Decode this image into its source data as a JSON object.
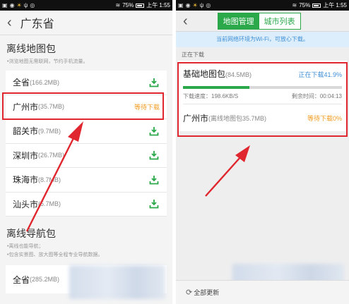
{
  "status_left": {
    "battery": "75%",
    "time": "上午 1:55"
  },
  "status_right": {
    "battery": "75%",
    "time": "上午 1:55"
  },
  "left": {
    "header_title": "广东省",
    "section_title": "离线地图包",
    "section_note": "•浏览地图无需联网，节约手机流量。",
    "items": [
      {
        "name": "全省",
        "size": "(166.2MB)"
      },
      {
        "name": "广州市",
        "size": "(35.7MB)",
        "status": "等待下载"
      },
      {
        "name": "韶关市",
        "size": "(9.7MB)"
      },
      {
        "name": "深圳市",
        "size": "(26.7MB)"
      },
      {
        "name": "珠海市",
        "size": "(8.7MB)"
      },
      {
        "name": "汕头市",
        "size": "(5.7MB)"
      }
    ],
    "nav_section_title": "离线导航包",
    "nav_notes": [
      "•离线也能导航；",
      "•包含实景图、放大图等全程专业导航数据。"
    ],
    "nav_item": {
      "name": "全省",
      "size": "(285.2MB)"
    }
  },
  "right": {
    "tabs": [
      "地图管理",
      "城市列表"
    ],
    "notice": "当前网络环境为Wi-Fi，可放心下载。",
    "downloading_label": "正在下载",
    "item1": {
      "name": "基础地图包",
      "size": "(84.5MB)",
      "status": "正在下载41.9%",
      "progress": 0.419,
      "speed": "下载速度：198.6KB/S",
      "remaining": "剩余时间：00:04:13"
    },
    "item2": {
      "name": "广州市",
      "size": "(离线地图包35.7MB)",
      "status": "等待下载0%"
    },
    "update_all": "全部更新"
  },
  "colors": {
    "accent_green": "#2aa84a",
    "highlight_red": "#e0262e",
    "wait_orange": "#f19b1f",
    "link_blue": "#3f8fd6"
  }
}
